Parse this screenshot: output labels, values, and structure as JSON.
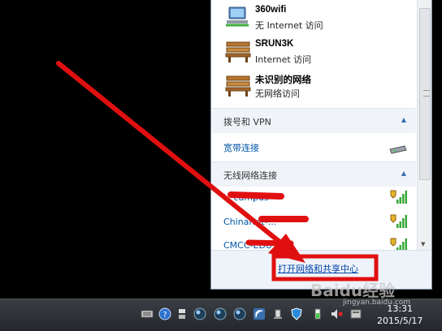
{
  "flyout": {
    "connections": [
      {
        "name": "360wifi",
        "status": "无 Internet 访问",
        "icon": "network-computer-icon"
      },
      {
        "name": "SRUN3K",
        "status": "Internet 访问",
        "icon": "network-bench-icon"
      },
      {
        "name": "未识别的网络",
        "status": "无网络访问",
        "icon": "network-bench-icon"
      }
    ],
    "dialup": {
      "header": "拨号和 VPN",
      "items": [
        {
          "label": "宽带连接",
          "icon": "modem-icon"
        }
      ]
    },
    "wireless": {
      "header": "无线网络连接",
      "items": [
        {
          "label": "i-_campus",
          "signal": 4
        },
        {
          "label": "ChinaNet-...",
          "signal": 4
        },
        {
          "label": "CMCC-EDU",
          "signal": 4
        }
      ]
    },
    "footer_link": "打开网络和共享中心"
  },
  "taskbar": {
    "time": "13:31",
    "date": "2015/5/17",
    "tray_icons": [
      "keyboard-icon",
      "help-icon",
      "network-switch-icon",
      "sphere-icon",
      "sphere-icon",
      "sphere-icon",
      "wifi-icon",
      "usb-icon",
      "shield-icon",
      "battery-icon",
      "volume-muted-icon",
      "action-center-icon"
    ]
  },
  "watermark": {
    "text": "Baidu经验",
    "sub": "jingyan.baidu.com"
  },
  "colors": {
    "annotation": "#e01010",
    "link": "#0044aa",
    "taskbar": "#2c2f34"
  }
}
